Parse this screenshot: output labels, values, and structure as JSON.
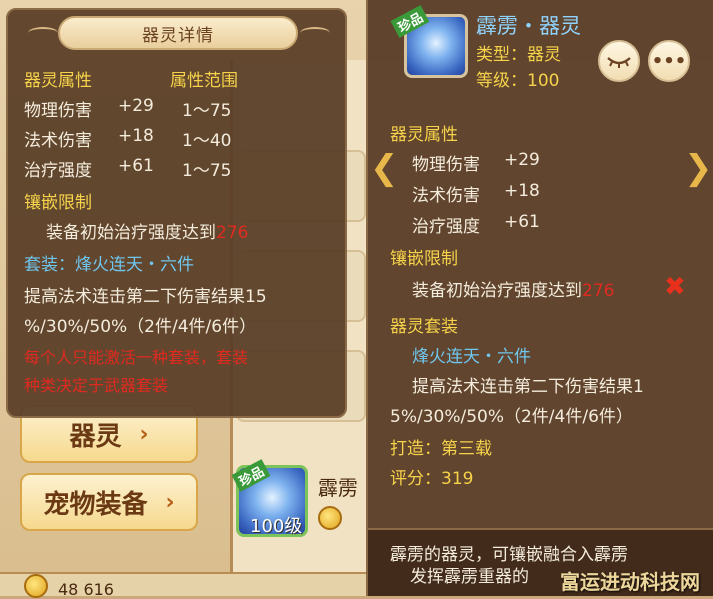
{
  "left_popup": {
    "title": "器灵详情",
    "attr_header": "器灵属性",
    "range_header": "属性范围",
    "attributes": [
      {
        "name": "物理伤害",
        "value": "+29",
        "range": "1～75"
      },
      {
        "name": "法术伤害",
        "value": "+18",
        "range": "1～40"
      },
      {
        "name": "治疗强度",
        "value": "+61",
        "range": "1～75"
      }
    ],
    "inlay_header": "镶嵌限制",
    "inlay_req_text": "装备初始治疗强度达到",
    "inlay_req_value": "276",
    "set_label": "套装：烽火连天・六件",
    "set_desc_line1": "提高法术连击第二下伤害结果15",
    "set_desc_line2": "%/30%/50%（2件/4件/6件）",
    "warning_line1": "每个人只能激活一种套装，套装",
    "warning_line2": "种类决定于武器套装"
  },
  "right_popup": {
    "tag": "珍品",
    "name": "霹雳・器灵",
    "type": "类型：器灵",
    "level": "等级：100",
    "attr_header": "器灵属性",
    "attributes": [
      {
        "name": "物理伤害",
        "value": "+29"
      },
      {
        "name": "法术伤害",
        "value": "+18"
      },
      {
        "name": "治疗强度",
        "value": "+61"
      }
    ],
    "inlay_header": "镶嵌限制",
    "inlay_req_text": "装备初始治疗强度达到",
    "inlay_req_value": "276",
    "set_header": "器灵套装",
    "set_name": "烽火连天・六件",
    "set_desc_line1": "提高法术连击第二下伤害结果1",
    "set_desc_line2": "5%/30%/50%（2件/4件/6件）",
    "forge": "打造：第三载",
    "score": "评分：319",
    "desc_line1": "霹雳的器灵，可镶嵌融合入霹雳",
    "desc_line2": "发挥霹雳重器的",
    "eye_icon": "eye-icon",
    "more_label": "•••"
  },
  "sidebar": {
    "btn_qiling": "器灵",
    "btn_pet": "宠物装备",
    "chev": "›"
  },
  "list_item": {
    "tag": "珍品",
    "level": "100级",
    "name": "霹雳"
  },
  "bottom": {
    "gold": "48 616"
  },
  "nav": {
    "left_arrow": "❮",
    "right_arrow": "❯",
    "x_mark": "✖"
  },
  "watermark": "富运进动科技网"
}
